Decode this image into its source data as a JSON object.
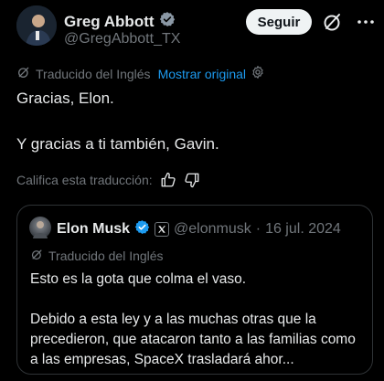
{
  "tweet": {
    "author_name": "Greg Abbott",
    "author_handle": "@GregAbbott_TX",
    "follow_label": "Seguir",
    "translated_label": "Traducido del Inglés",
    "show_original_label": "Mostrar original",
    "paragraphs": [
      "Gracias, Elon.",
      "Y gracias a ti también, Gavin."
    ],
    "rate_translation_label": "Califica esta traducción:"
  },
  "quote": {
    "author_name": "Elon Musk",
    "author_handle": "@elonmusk",
    "separator": "·",
    "date": "16 jul. 2024",
    "translated_label": "Traducido del Inglés",
    "paragraphs": [
      "Esto es la gota que colma el vaso.",
      "Debido a esta ley y a las muchas otras que la precedieron, que atacaron tanto a las familias como a las empresas, SpaceX trasladará ahor..."
    ]
  },
  "icons": {
    "verified": "verified-badge-icon",
    "grok": "grok-icon",
    "more": "more-icon",
    "translate": "translate-icon",
    "gear": "gear-icon",
    "thumbs_up": "thumbs-up-icon",
    "thumbs_down": "thumbs-down-icon",
    "x_logo": "x-logo-icon"
  },
  "colors": {
    "background": "#000000",
    "text": "#e7e9ea",
    "muted": "#71767b",
    "link": "#1d9bf0",
    "verified": "#1d9bf0",
    "border": "#2f3336"
  }
}
